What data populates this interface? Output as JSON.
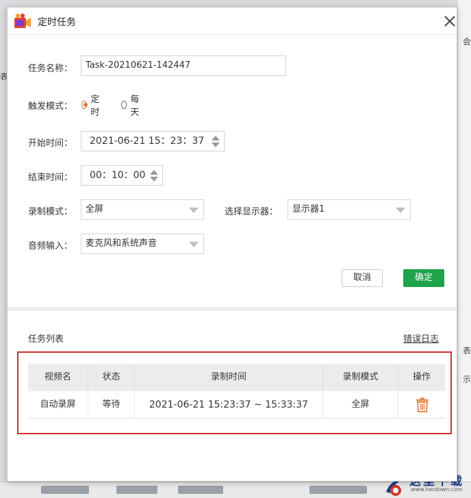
{
  "window": {
    "title": "定时任务",
    "close_glyph": "✕"
  },
  "form": {
    "task_name_label": "任务名称：",
    "task_name_value": "Task-20210621-142447",
    "trigger_label": "触发模式：",
    "trigger_options": [
      {
        "label": "定时",
        "checked": true
      },
      {
        "label": "每天",
        "checked": false
      }
    ],
    "start_label": "开始时间：",
    "start_value": "2021-06-21 15：23：37",
    "end_label": "结束时间：",
    "end_value": "00：10：00",
    "record_mode_label": "录制模式：",
    "record_mode_value": "全屏",
    "display_label": "选择显示器：",
    "display_value": "显示器1",
    "audio_label": "音频输入：",
    "audio_value": "麦克风和系统声音",
    "cancel_label": "取消",
    "ok_label": "确定"
  },
  "task_list": {
    "title": "任务列表",
    "error_log_label": "错误日志",
    "columns": [
      "视频名",
      "状态",
      "录制时间",
      "录制模式",
      "操作"
    ],
    "rows": [
      {
        "name": "自动录屏",
        "status": "等待",
        "time": "2021-06-21 15:23:37 ~ 15:33:37",
        "mode": "全屏"
      }
    ]
  },
  "background": {
    "frag_top": "会",
    "frag_left": "表",
    "frag_right1": "表",
    "frag_right2": "示"
  },
  "watermark": {
    "text": "这里下载",
    "url": "www.herdown.com"
  },
  "colors": {
    "accent_orange": "#e07a3a",
    "ok_green": "#1fa34a",
    "highlight_red": "#d22d2d"
  },
  "icons": {
    "app": "video-camera-icon",
    "close": "close-icon",
    "delete": "trash-icon"
  }
}
